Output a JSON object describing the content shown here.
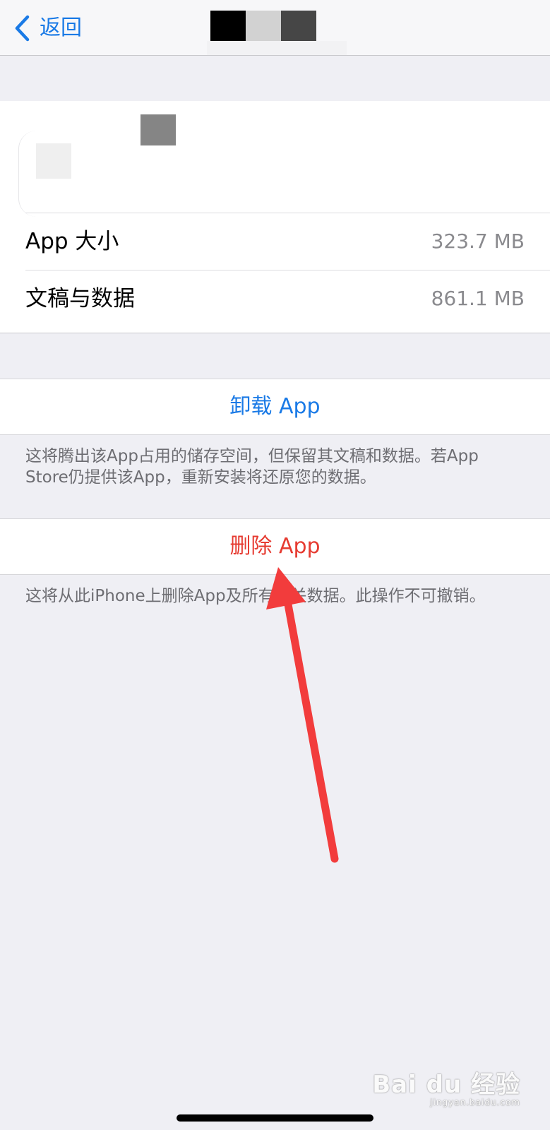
{
  "nav": {
    "back_label": "返回",
    "back_icon": "chevron-left-icon",
    "accent_color": "#1a7ae6"
  },
  "app_info": {
    "rows": [
      {
        "label": "App 大小",
        "value": "323.7 MB"
      },
      {
        "label": "文稿与数据",
        "value": "861.1 MB"
      }
    ]
  },
  "offload": {
    "label": "卸载 App",
    "color": "#1a7ae6",
    "description": "这将腾出该App占用的储存空间，但保留其文稿和数据。若App Store仍提供该App，重新安装将还原您的数据。"
  },
  "delete": {
    "label": "删除 App",
    "color": "#e63b31",
    "description": "这将从此iPhone上删除App及所有相关数据。此操作不可撤销。"
  },
  "annotation": {
    "arrow_color": "#f23c3c",
    "arrow_icon": "red-arrow-pointer"
  },
  "watermark": {
    "main": "Bai du 经验",
    "sub": "jingyan.baidu.com"
  }
}
